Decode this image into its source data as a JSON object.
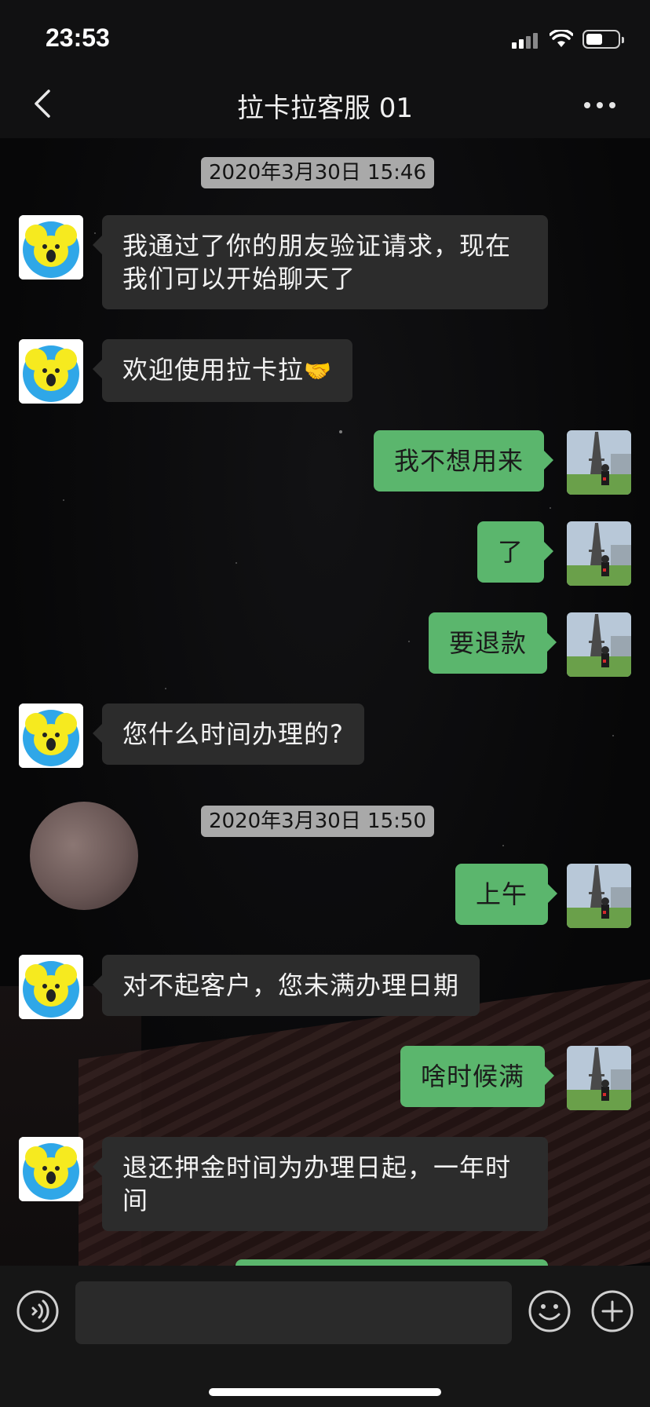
{
  "status_bar": {
    "time": "23:53"
  },
  "nav": {
    "title": "拉卡拉客服 01"
  },
  "timestamps": [
    "2020年3月30日 15:46",
    "2020年3月30日 15:50"
  ],
  "messages": [
    {
      "side": "incoming",
      "text": "我通过了你的朋友验证请求，现在我们可以开始聊天了"
    },
    {
      "side": "incoming",
      "text": "欢迎使用拉卡拉",
      "emoji": "🤝"
    },
    {
      "side": "outgoing",
      "text": "我不想用来"
    },
    {
      "side": "outgoing",
      "text": "了"
    },
    {
      "side": "outgoing",
      "text": "要退款"
    },
    {
      "side": "incoming",
      "text": "您什么时间办理的?"
    },
    {
      "side": "outgoing",
      "text": "上午"
    },
    {
      "side": "incoming",
      "text": "对不起客户，您未满办理日期"
    },
    {
      "side": "outgoing",
      "text": "啥时候满"
    },
    {
      "side": "incoming",
      "text": "退还押金时间为办理日起，一年时间"
    }
  ],
  "input": {
    "placeholder": ""
  },
  "colors": {
    "outgoing_bubble": "#5bb66d",
    "incoming_bubble": "#2c2c2c",
    "background": "#0b0b0c"
  }
}
